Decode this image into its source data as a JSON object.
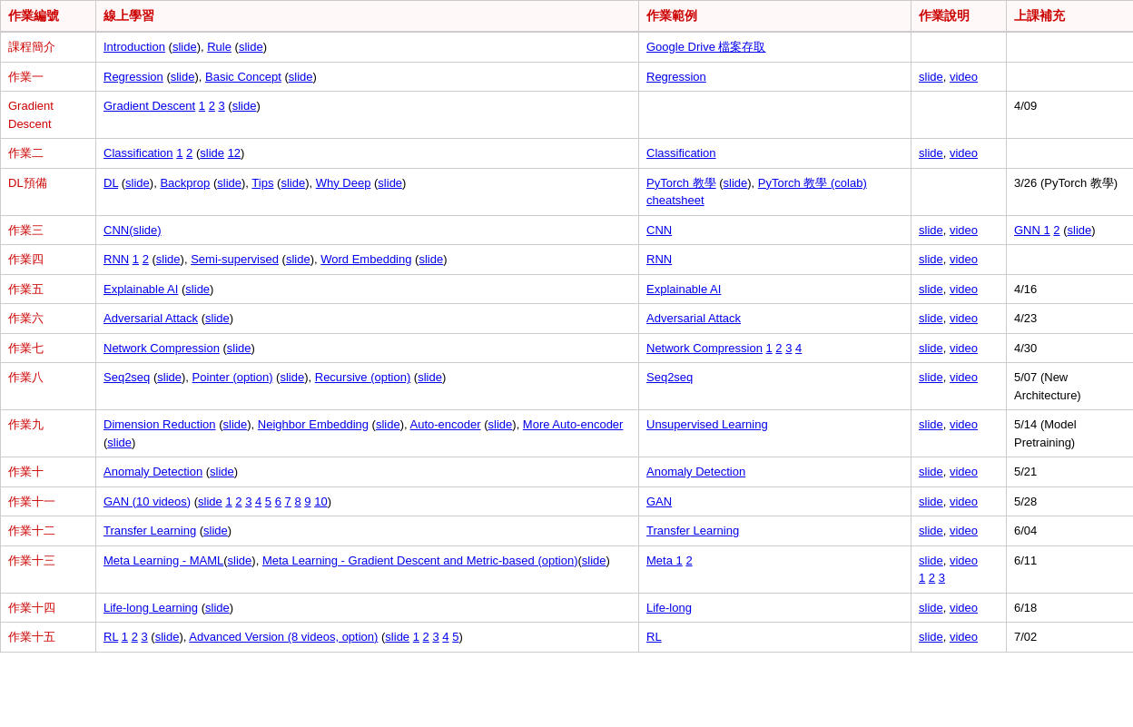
{
  "headers": {
    "col1": "作業編號",
    "col2": "線上學習",
    "col3": "作業範例",
    "col4": "作業說明",
    "col5": "上課補充"
  },
  "rows": [
    {
      "id": "課程簡介",
      "col2_html": "<a href='#' data-name='intro-link'>Introduction</a> (<a href='#' data-name='intro-slide-link'>slide</a>), <a href='#' data-name='rule-link'>Rule</a> (<a href='#' data-name='rule-slide-link'>slide</a>)",
      "col3_html": "<a href='#' data-name='google-drive-link'>Google Drive 檔案存取</a>",
      "col4_html": "",
      "col5_html": ""
    },
    {
      "id": "作業一",
      "col2_html": "<a href='#'>Regression</a> (<a href='#'>slide</a>), <a href='#'>Basic Concept</a> (<a href='#'>slide</a>)",
      "col3_html": "<a href='#'>Regression</a>",
      "col4_html": "<a href='#'>slide</a>, <a href='#'>video</a>",
      "col5_html": ""
    },
    {
      "id": "Gradient\nDescent",
      "col2_html": "<a href='#'>Gradient Descent</a> <a href='#'>1</a> <a href='#'>2</a> <a href='#'>3</a> (<a href='#'>slide</a>)",
      "col3_html": "",
      "col4_html": "",
      "col5_html": "4/09"
    },
    {
      "id": "作業二",
      "col2_html": "<a href='#'>Classification</a> <a href='#'>1</a> <a href='#'>2</a> (<a href='#'>slide</a> <a href='#'>12</a>)",
      "col3_html": "<a href='#'>Classification</a>",
      "col4_html": "<a href='#'>slide</a>, <a href='#'>video</a>",
      "col5_html": ""
    },
    {
      "id": "DL預備",
      "col2_html": "<a href='#'>DL</a> (<a href='#'>slide</a>), <a href='#'>Backprop</a> (<a href='#'>slide</a>), <a href='#'>Tips</a> (<a href='#'>slide</a>), <a href='#'>Why Deep</a> (<a href='#'>slide</a>)",
      "col3_html": "<a href='#'>PyTorch 教學</a> (<a href='#'>slide</a>), <a href='#'>PyTorch 教學 (colab)</a> <a href='#'>cheatsheet</a>",
      "col4_html": "",
      "col5_html": "3/26 (PyTorch 教學)"
    },
    {
      "id": "作業三",
      "col2_html": "<a href='#'>CNN(slide)</a>",
      "col3_html": "<a href='#'>CNN</a>",
      "col4_html": "<a href='#'>slide</a>, <a href='#'>video</a>",
      "col5_html": "<a href='#'>GNN 1</a> <a href='#'>2</a> (<a href='#'>slide</a>)"
    },
    {
      "id": "作業四",
      "col2_html": "<a href='#'>RNN</a> <a href='#'>1</a> <a href='#'>2</a> (<a href='#'>slide</a>), <a href='#'>Semi-supervised</a> (<a href='#'>slide</a>), <a href='#'>Word Embedding</a> (<a href='#'>slide</a>)",
      "col3_html": "<a href='#'>RNN</a>",
      "col4_html": "<a href='#'>slide</a>, <a href='#'>video</a>",
      "col5_html": ""
    },
    {
      "id": "作業五",
      "col2_html": "<a href='#'>Explainable AI</a> (<a href='#'>slide</a>)",
      "col3_html": "<a href='#'>Explainable AI</a>",
      "col4_html": "<a href='#'>slide</a>, <a href='#'>video</a>",
      "col5_html": "4/16"
    },
    {
      "id": "作業六",
      "col2_html": "<a href='#'>Adversarial Attack</a> (<a href='#'>slide</a>)",
      "col3_html": "<a href='#'>Adversarial Attack</a>",
      "col4_html": "<a href='#'>slide</a>, <a href='#'>video</a>",
      "col5_html": "4/23"
    },
    {
      "id": "作業七",
      "col2_html": "<a href='#'>Network Compression</a> (<a href='#'>slide</a>)",
      "col3_html": "<a href='#'>Network Compression</a> <a href='#'>1</a> <a href='#'>2</a> <a href='#'>3</a> <a href='#'>4</a>",
      "col4_html": "<a href='#'>slide</a>, <a href='#'>video</a>",
      "col5_html": "4/30"
    },
    {
      "id": "作業八",
      "col2_html": "<a href='#'>Seq2seq</a> (<a href='#'>slide</a>), <a href='#'>Pointer (option)</a> (<a href='#'>slide</a>), <a href='#'>Recursive (option)</a> (<a href='#'>slide</a>)",
      "col3_html": "<a href='#'>Seq2seq</a>",
      "col4_html": "<a href='#'>slide</a>, <a href='#'>video</a>",
      "col5_html": "5/07 (New Architecture)"
    },
    {
      "id": "作業九",
      "col2_html": "<a href='#'>Dimension Reduction</a> (<a href='#'>slide</a>), <a href='#'>Neighbor Embedding</a> (<a href='#'>slide</a>), <a href='#'>Auto-encoder</a> (<a href='#'>slide</a>), <a href='#'>More Auto-encoder</a> (<a href='#'>slide</a>)",
      "col3_html": "<a href='#'>Unsupervised Learning</a>",
      "col4_html": "<a href='#'>slide</a>, <a href='#'>video</a>",
      "col5_html": "5/14 (Model Pretraining)"
    },
    {
      "id": "作業十",
      "col2_html": "<a href='#'>Anomaly Detection</a> (<a href='#'>slide</a>)",
      "col3_html": "<a href='#'>Anomaly Detection</a>",
      "col4_html": "<a href='#'>slide</a>, <a href='#'>video</a>",
      "col5_html": "5/21"
    },
    {
      "id": "作業十一",
      "col2_html": "<a href='#'>GAN (10 videos)</a> (<a href='#'>slide</a> <a href='#'>1</a> <a href='#'>2</a> <a href='#'>3</a> <a href='#'>4</a> <a href='#'>5</a> <a href='#'>6</a> <a href='#'>7</a> <a href='#'>8</a> <a href='#'>9</a> <a href='#'>10</a>)",
      "col3_html": "<a href='#'>GAN</a>",
      "col4_html": "<a href='#'>slide</a>, <a href='#'>video</a>",
      "col5_html": "5/28"
    },
    {
      "id": "作業十二",
      "col2_html": "<a href='#'>Transfer Learning</a> (<a href='#'>slide</a>)",
      "col3_html": "<a href='#'>Transfer Learning</a>",
      "col4_html": "<a href='#'>slide</a>, <a href='#'>video</a>",
      "col5_html": "6/04"
    },
    {
      "id": "作業十三",
      "col2_html": "<a href='#'>Meta Learning - MAML</a>(<a href='#'>slide</a>), <a href='#'>Meta Learning - Gradient Descent and Metric-based (option)</a>(<a href='#'>slide</a>)",
      "col3_html": "<a href='#'>Meta 1</a> <a href='#'>2</a>",
      "col4_html": "<a href='#'>slide</a>, <a href='#'>video</a><br><a href='#'>1</a> <a href='#'>2</a> <a href='#'>3</a>",
      "col5_html": "6/11"
    },
    {
      "id": "作業十四",
      "col2_html": "<a href='#'>Life-long Learning</a> (<a href='#'>slide</a>)",
      "col3_html": "<a href='#'>Life-long</a>",
      "col4_html": "<a href='#'>slide</a>, <a href='#'>video</a>",
      "col5_html": "6/18"
    },
    {
      "id": "作業十五",
      "col2_html": "<a href='#'>RL</a> <a href='#'>1</a> <a href='#'>2</a> <a href='#'>3</a> (<a href='#'>slide</a>), <a href='#'>Advanced Version (8 videos, option)</a> (<a href='#'>slide</a> <a href='#'>1</a> <a href='#'>2</a> <a href='#'>3</a> <a href='#'>4</a> <a href='#'>5</a>)",
      "col3_html": "<a href='#'>RL</a>",
      "col4_html": "<a href='#'>slide</a>, <a href='#'>video</a>",
      "col5_html": "7/02"
    }
  ]
}
